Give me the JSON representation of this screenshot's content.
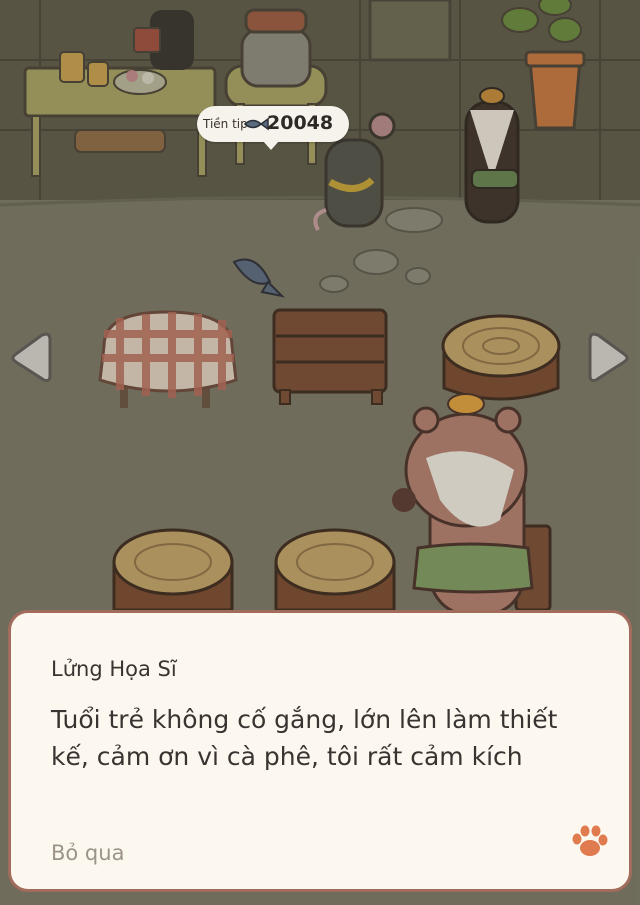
{
  "tip": {
    "label": "Tiền tip",
    "value": "20048",
    "icon": "fish-icon"
  },
  "navigation": {
    "left_icon": "arrow-left-icon",
    "right_icon": "arrow-right-icon"
  },
  "dialog": {
    "speaker": "Lửng Họa Sĩ",
    "text_line1": "Tuổi trẻ không cố gắng, lớn lên làm thiết",
    "text_line2": "kế, cảm ơn vì cà phê, tôi rất cảm kích",
    "skip_label": "Bỏ qua",
    "continue_icon": "paw-icon"
  },
  "colors": {
    "dialog_border": "#a26c5d",
    "dialog_bg": "#fdf8ef",
    "paw": "#e07a4f",
    "floor": "#7a7866"
  }
}
